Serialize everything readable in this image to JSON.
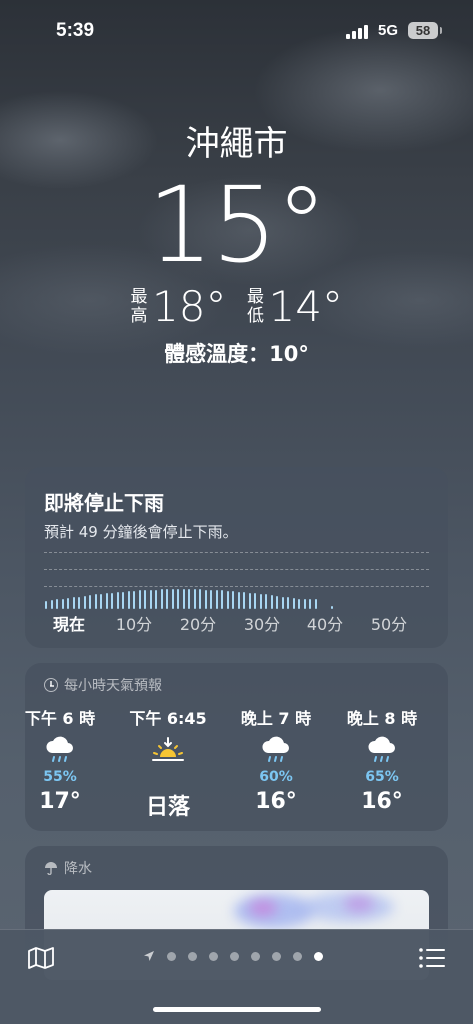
{
  "status_bar": {
    "time": "5:39",
    "network": "5G",
    "battery": "58"
  },
  "current": {
    "city": "沖繩市",
    "temperature": "15°",
    "high_label": "最高",
    "high": "18°",
    "low_label": "最低",
    "low": "14°",
    "feels_like": "體感溫度：10°"
  },
  "rain_card": {
    "title": "即將停止下雨",
    "description": "預計 49 分鐘後會停止下雨。",
    "x_labels": [
      "現在",
      "10分",
      "20分",
      "30分",
      "40分",
      "50分"
    ],
    "intensity_note": "rain intensity bars shown for the first ~49 minutes"
  },
  "hourly": {
    "header": "每小時天氣預報",
    "items": [
      {
        "time": "下午 6 時",
        "icon": "cloud-rain-icon",
        "precip": "55%",
        "temp": "17°"
      },
      {
        "time": "下午 6:45",
        "icon": "sunset-icon",
        "precip": "",
        "temp": "日落"
      },
      {
        "time": "晚上 7 時",
        "icon": "cloud-rain-icon",
        "precip": "60%",
        "temp": "16°"
      },
      {
        "time": "晚上 8 時",
        "icon": "cloud-rain-icon",
        "precip": "65%",
        "temp": "16°"
      }
    ]
  },
  "precipitation": {
    "header": "降水"
  },
  "pager": {
    "pages": 8,
    "active_index": 7
  },
  "colors": {
    "rain_bar": "#a8d6f2",
    "precip_pct": "#7cc6f2",
    "sun": "#f6c533"
  }
}
